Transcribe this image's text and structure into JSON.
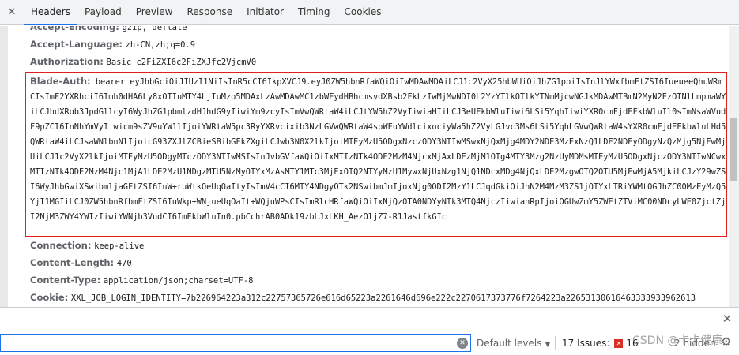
{
  "tabs": [
    {
      "label": "Headers",
      "active": true
    },
    {
      "label": "Payload",
      "active": false
    },
    {
      "label": "Preview",
      "active": false
    },
    {
      "label": "Response",
      "active": false
    },
    {
      "label": "Initiator",
      "active": false
    },
    {
      "label": "Timing",
      "active": false
    },
    {
      "label": "Cookies",
      "active": false
    }
  ],
  "headers": {
    "accept_encoding": {
      "name": "Accept-Encoding:",
      "value": "gzip, deflate"
    },
    "accept_language": {
      "name": "Accept-Language:",
      "value": "zh-CN,zh;q=0.9"
    },
    "authorization": {
      "name": "Authorization:",
      "value": "Basic c2FiZXI6c2FiZXJfc2VjcmV0"
    },
    "blade_auth": {
      "name": "Blade-Auth:",
      "value": "bearer eyJhbGciOiJIUzI1NiIsInR5cCI6IkpXVCJ9.eyJ0ZW5hbnRfaWQiOiIwMDAwMDAiLCJ1c2VyX25hbWUiOiJhZG1pbiIsInJlYWxfbmFtZSI6IueueeQhuWRmCIsImF2YXRhciI6Imh0dHA6Ly8xOTIuMTY4LjIuMzo5MDAxLzAwMDAwMC1zbWFydHBhcmsvdXBsb2FkLzIwMjMwNDI0L2YzYTlkOTlkYTNmMjcwNGJkMDAwMTBmN2MyN2EzOTNlLmpmaWYiLCJhdXRob3JpdGllcyI6WyJhZG1pbmlzdHJhdG9yIiwiYm9zcyIsImVwQWRtaW4iLCJtYW5hZ2VyIiwiaHIiLCJ3eUFkbWluIiwi6LSi5YqhIiwiYXR0cmFjdEFkbWluIl0sImNsaWVudF9pZCI6InNhYmVyIiwicm9sZV9uYW1lIjoiYWRtaW5pc3RyYXRvcixib3NzLGVwQWRtaW4sbWFuYWdlcixociyWa5hZ2VyLGJvc3Ms6LSi5YqhLGVwQWRtaW4sYXR0cmFjdEFkbWluLHd5QWRtaW4iLCJsaWNlbnNlIjoicG93ZXJlZCBieSBibGFkZXgiLCJwb3N0X2lkIjoiMTEyMzU5ODgxNzczODY3NTIwMSwxNjQxMjg4MDY2NDE3MzExNzQ1LDE2NDEyODgyNzQzMjg5NjEwMjUiLCJ1c2VyX2lkIjoiMTEyMzU5ODgyMTczODY3NTIwMSIsInJvbGVfaWQiOiIxMTIzNTk4ODE2MzM4NjcxMjAxLDEzMjM1OTg4MTY3Mzg2NzUyMDMsMTEyMzU5ODgxNjczODY3NTIwNCwxMTIzNTk4ODE2MzM4Njc1MjA1LDE2MzU1NDgzMTU5NzMyOTYxMzAsMTY1MTc3MjExOTQ2NTYyMzU1MywxNjUxNzg1NjQ1NDcxMDg4NjQxLDE2MzgwOTQ2OTU5MjEwMjA5MjkiLCJzY29wZSI6WyJhbGwiXSwibmljaGFtZSI6IuW+ruWtkOeUqOaItyIsImV4cCI6MTY4NDgyOTk2NSwibmJmIjoxNjg0ODI2MzY1LCJqdGkiOiJhN2M4MzM3ZS1jOTYxLTRiYWMtOGJhZC00MzEyMzQ5YjI1MGIiLCJ0ZW5hbnRfbmFtZSI6IuWkp+WNjueUqOaIt+WQjuWPsCIsImRlcHRfaWQiOiIxNjQzOTA0NDYyNTk3MTQ4NjczIiwianRpIjoiOGUwZmY5ZWEtZTViMC00NDcyLWE0ZjctZjI2NjM3ZWY4YWIzIiwiYWNjb3VudCI6ImFkbWluIn0.pbCchrAB0ADk19zbLJxLKH_AezOljZ7-R1JastfkGIc"
    },
    "connection": {
      "name": "Connection:",
      "value": "keep-alive"
    },
    "content_length": {
      "name": "Content-Length:",
      "value": "470"
    },
    "content_type": {
      "name": "Content-Type:",
      "value": "application/json;charset=UTF-8"
    },
    "cookie": {
      "name": "Cookie:",
      "value": "XXL_JOB_LOGIN_IDENTITY=7b226964223a312c22757365726e616d65223a2261646d696e222c2270617373776f7264223a22653130616463333933962613"
    }
  },
  "console": {
    "levels_label": "Default levels",
    "issues_label": "17 Issues:",
    "error_count": "16",
    "hidden_label": "2 hidden",
    "watermark": "CSDN @卡卡健康"
  },
  "colors": {
    "highlight": "#e02020",
    "accent": "#1a73e8",
    "error": "#d93025"
  }
}
